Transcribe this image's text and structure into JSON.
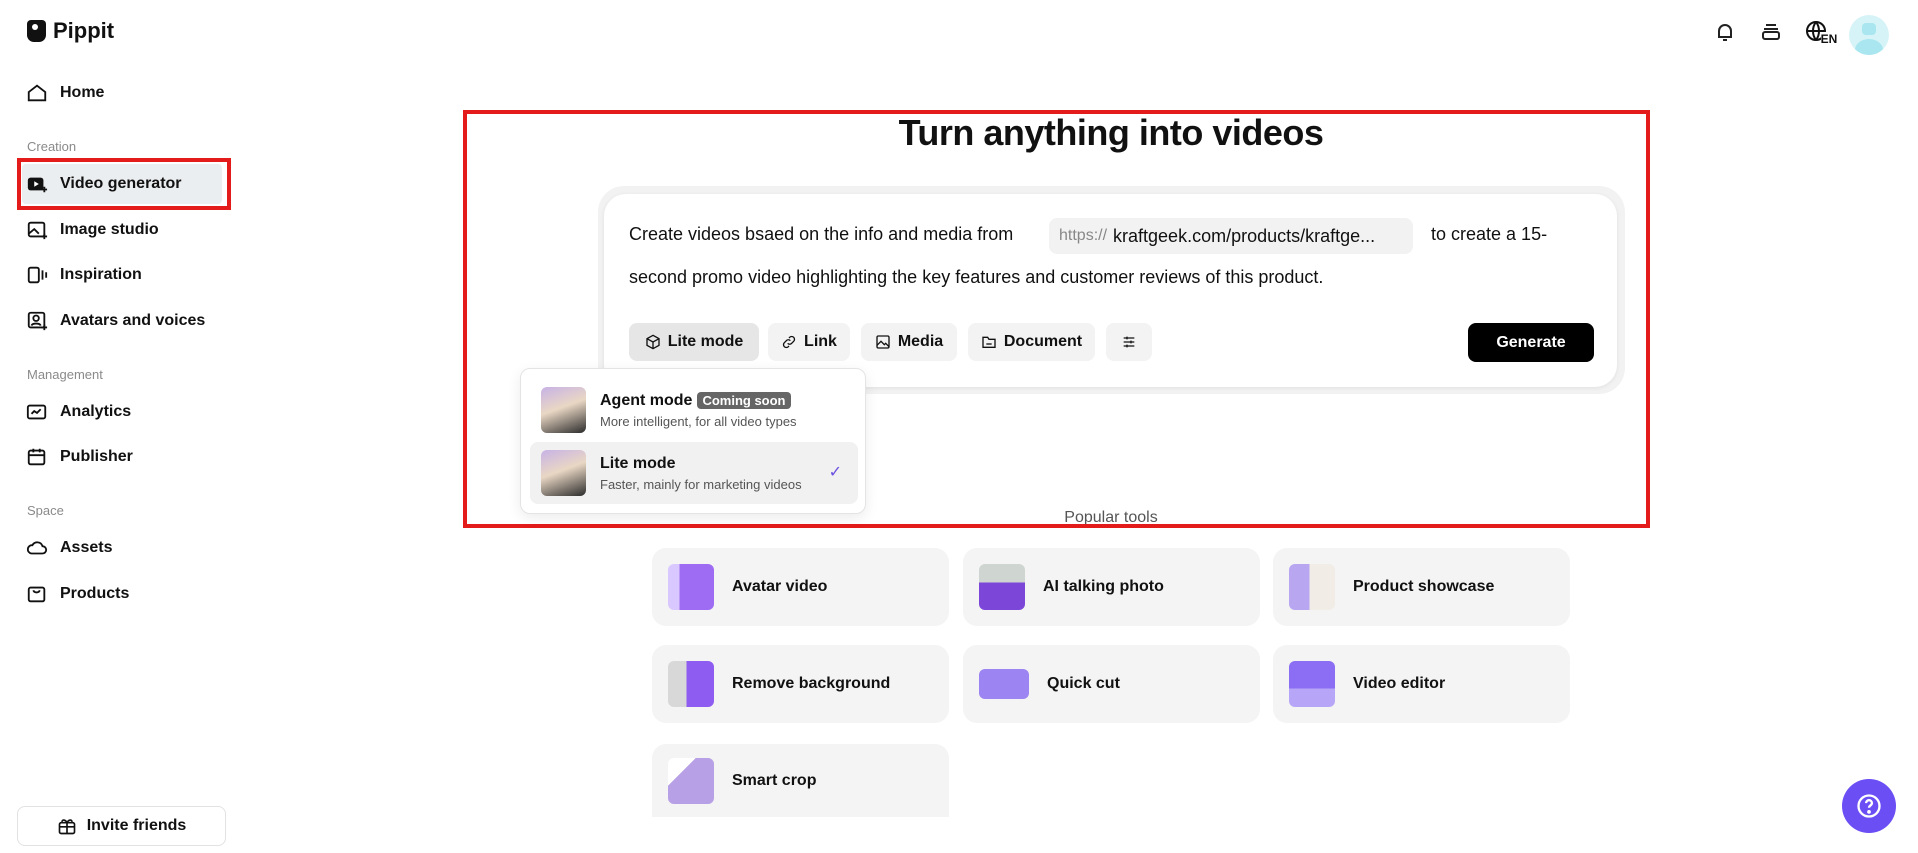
{
  "app": {
    "name": "Pippit"
  },
  "sidebar": {
    "home": "Home",
    "sections": {
      "creation": "Creation",
      "management": "Management",
      "space": "Space"
    },
    "items": [
      {
        "label": "Video generator",
        "active": true
      },
      {
        "label": "Image studio"
      },
      {
        "label": "Inspiration"
      },
      {
        "label": "Avatars and voices"
      },
      {
        "label": "Analytics"
      },
      {
        "label": "Publisher"
      },
      {
        "label": "Assets"
      },
      {
        "label": "Products"
      }
    ],
    "invite": "Invite friends"
  },
  "header": {
    "language": "EN"
  },
  "main": {
    "title": "Turn anything into videos",
    "prompt": {
      "before": "Create videos bsaed on the info and media from",
      "url_prefix": "https://",
      "url": "kraftgeek.com/products/kraftge...",
      "after_line1": "to create a 15-",
      "line2": "second promo video highlighting the key features and customer reviews of this product."
    },
    "toolbar": {
      "mode": "Lite mode",
      "link": "Link",
      "media": "Media",
      "document": "Document",
      "generate": "Generate"
    },
    "mode_dropdown": [
      {
        "title": "Agent mode",
        "badge": "Coming soon",
        "desc": "More intelligent, for all video types"
      },
      {
        "title": "Lite mode",
        "desc": "Faster, mainly for marketing videos",
        "selected": true
      }
    ],
    "popular_title": "Popular tools",
    "tools": [
      "Avatar video",
      "AI talking photo",
      "Product showcase",
      "Remove background",
      "Quick cut",
      "Video editor",
      "Smart crop"
    ]
  },
  "colors": {
    "accent": "#6c4ef5",
    "highlight": "#e31b1b"
  }
}
